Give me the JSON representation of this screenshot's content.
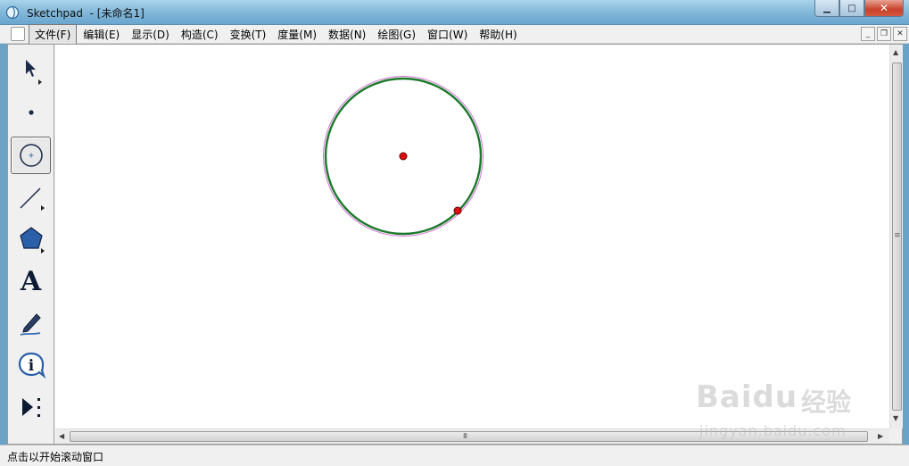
{
  "window": {
    "title": "Sketchpad  - [未命名1]",
    "minimize_glyph": "▁",
    "maximize_glyph": "□",
    "close_glyph": "✕"
  },
  "menu": {
    "items": [
      {
        "label": "文件(F)",
        "active": true
      },
      {
        "label": "编辑(E)"
      },
      {
        "label": "显示(D)"
      },
      {
        "label": "构造(C)"
      },
      {
        "label": "变换(T)"
      },
      {
        "label": "度量(M)"
      },
      {
        "label": "数据(N)"
      },
      {
        "label": "绘图(G)"
      },
      {
        "label": "窗口(W)"
      },
      {
        "label": "帮助(H)"
      }
    ],
    "mdi_minimize": "_",
    "mdi_restore": "❐",
    "mdi_close": "✕"
  },
  "toolbox": {
    "tools": [
      {
        "name": "arrow-select-tool",
        "icon": "arrow-pointer-icon"
      },
      {
        "name": "point-tool",
        "icon": "point-icon"
      },
      {
        "name": "compass-tool",
        "icon": "circle-icon",
        "active": true
      },
      {
        "name": "straightedge-tool",
        "icon": "line-segment-icon"
      },
      {
        "name": "polygon-tool",
        "icon": "pentagon-icon"
      },
      {
        "name": "text-tool",
        "icon": "letter-a-icon",
        "glyph": "A"
      },
      {
        "name": "marker-tool",
        "icon": "marker-pen-icon"
      },
      {
        "name": "information-tool",
        "icon": "info-icon",
        "glyph": "i"
      },
      {
        "name": "custom-tool",
        "icon": "play-dots-icon"
      }
    ]
  },
  "colors": {
    "circle_stroke": "#1a7a2a",
    "selection_halo": "#d070d0",
    "point_fill": "#e01010",
    "point_stroke": "#600000"
  },
  "scrollbar": {
    "grip": "III",
    "vgrip": "≡"
  },
  "status": {
    "text": "点击以开始滚动窗口"
  },
  "watermark": {
    "brand": "Bai",
    "brand2": "du",
    "cn": "经验",
    "url": "jingyan.baidu.com"
  }
}
